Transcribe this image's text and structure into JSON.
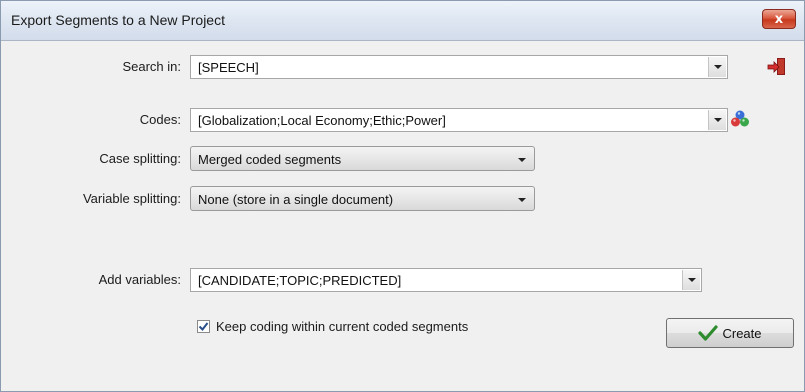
{
  "window": {
    "title": "Export Segments to a New Project",
    "close_glyph": "x"
  },
  "form": {
    "search_in": {
      "label": "Search in:",
      "value": "[SPEECH]"
    },
    "codes": {
      "label": "Codes:",
      "value": "[Globalization;Local Economy;Ethic;Power]"
    },
    "case_splitting": {
      "label": "Case splitting:",
      "value": "Merged coded segments"
    },
    "variable_splitting": {
      "label": "Variable splitting:",
      "value": "None (store in a single document)"
    },
    "add_variables": {
      "label": "Add variables:",
      "value": "[CANDIDATE;TOPIC;PREDICTED]"
    },
    "keep_coding": {
      "label": "Keep coding within current coded segments",
      "checked": true
    }
  },
  "buttons": {
    "create": {
      "label": "Create",
      "icon": "checkmark-icon"
    },
    "exit": {
      "icon": "exit-door-icon"
    },
    "code_picker": {
      "icon": "colored-balls-icon"
    }
  },
  "colors": {
    "close_button": "#d9593f",
    "checkmark": "#2e8b2e",
    "exit_door": "#b22222"
  }
}
